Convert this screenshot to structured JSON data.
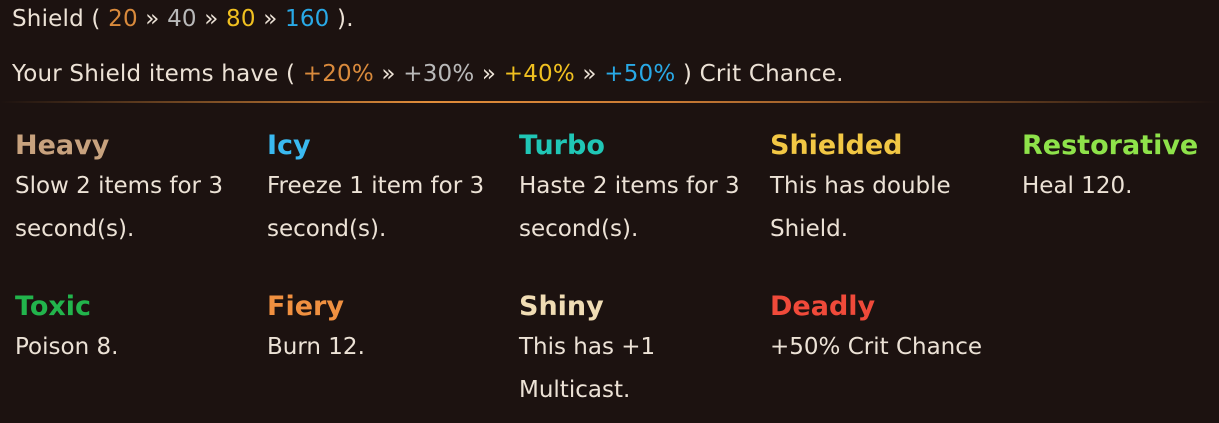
{
  "tier_line": {
    "prefix": "Shield ( ",
    "tiers": [
      "20",
      "40",
      "80",
      "160"
    ],
    "sep": " » ",
    "suffix": " )."
  },
  "crit_line": {
    "prefix": "Your Shield items have ( ",
    "tiers": [
      "+20%",
      "+30%",
      "+40%",
      "+50%"
    ],
    "sep": " » ",
    "suffix": " ) Crit Chance."
  },
  "tier_colors": {
    "bronze": "#d98a3c",
    "silver": "#b9b9b9",
    "gold": "#f0c020",
    "diamond": "#29a9e6"
  },
  "enchantments": [
    {
      "name": "Heavy",
      "color": "#c8a27e",
      "description": "Slow 2 items for 3 second(s)."
    },
    {
      "name": "Icy",
      "color": "#3ab9f0",
      "description": "Freeze 1 item for 3 second(s)."
    },
    {
      "name": "Turbo",
      "color": "#20c6b6",
      "description": "Haste 2 items for 3 second(s)."
    },
    {
      "name": "Shielded",
      "color": "#f2c744",
      "description": "This has double Shield."
    },
    {
      "name": "Restorative",
      "color": "#8ee24a",
      "description": "Heal 120."
    },
    {
      "name": "Toxic",
      "color": "#22b44c",
      "description": "Poison 8."
    },
    {
      "name": "Fiery",
      "color": "#f09040",
      "description": "Burn 12."
    },
    {
      "name": "Shiny",
      "color": "#f0dcb4",
      "description": "This has +1 Multicast."
    },
    {
      "name": "Deadly",
      "color": "#f04a3a",
      "description": "+50% Crit Chance"
    }
  ]
}
